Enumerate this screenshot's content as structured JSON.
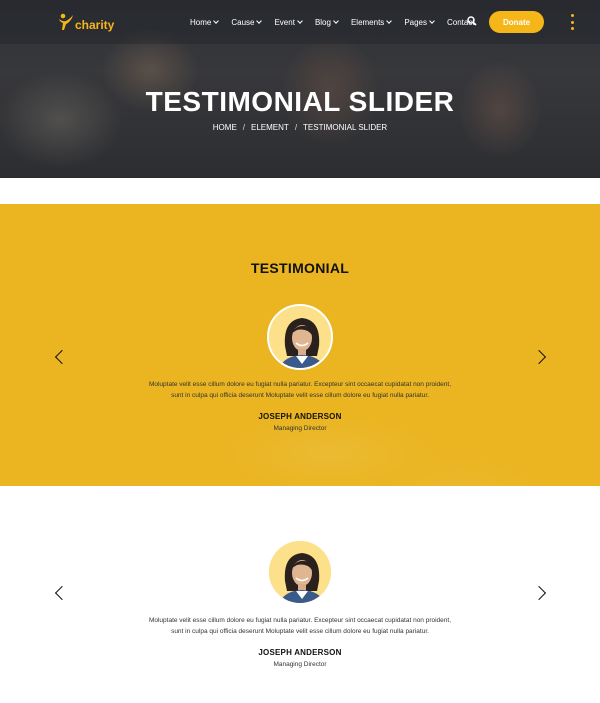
{
  "brand": {
    "name": "charity",
    "accent": "#f5b619",
    "yellow_bg": "#eab521"
  },
  "nav": {
    "items": [
      {
        "label": "Home",
        "dropdown": true
      },
      {
        "label": "Cause",
        "dropdown": true
      },
      {
        "label": "Event",
        "dropdown": true
      },
      {
        "label": "Blog",
        "dropdown": true
      },
      {
        "label": "Elements",
        "dropdown": true
      },
      {
        "label": "Pages",
        "dropdown": true
      },
      {
        "label": "Contact",
        "dropdown": false
      }
    ],
    "search_icon": "search-icon",
    "donate_label": "Donate",
    "menu_icon": "vertical-dots-icon"
  },
  "hero": {
    "title": "TESTIMONIAL SLIDER",
    "breadcrumb": [
      "HOME",
      "ELEMENT",
      "TESTIMONIAL SLIDER"
    ],
    "separator": "/"
  },
  "section1": {
    "title": "TESTIMONIAL",
    "quote_line1": "Moluptate velit esse cillum dolore eu fugiat nulla pariatur. Excepteur sint occaecat cupidatat non proident,",
    "quote_line2": "sunt in culpa qui officia deserunt Moluptate velit esse cillum dolore eu fugiat nulla pariatur.",
    "name": "JOSEPH ANDERSON",
    "role": "Managing Director"
  },
  "section2": {
    "quote_line1": "Moluptate velit esse cillum dolore eu fugiat nulla pariatur. Excepteur sint occaecat cupidatat non proident,",
    "quote_line2": "sunt in culpa qui officia deserunt Moluptate velit esse cillum dolore eu fugiat nulla pariatur.",
    "name": "JOSEPH ANDERSON",
    "role": "Managing Director"
  }
}
